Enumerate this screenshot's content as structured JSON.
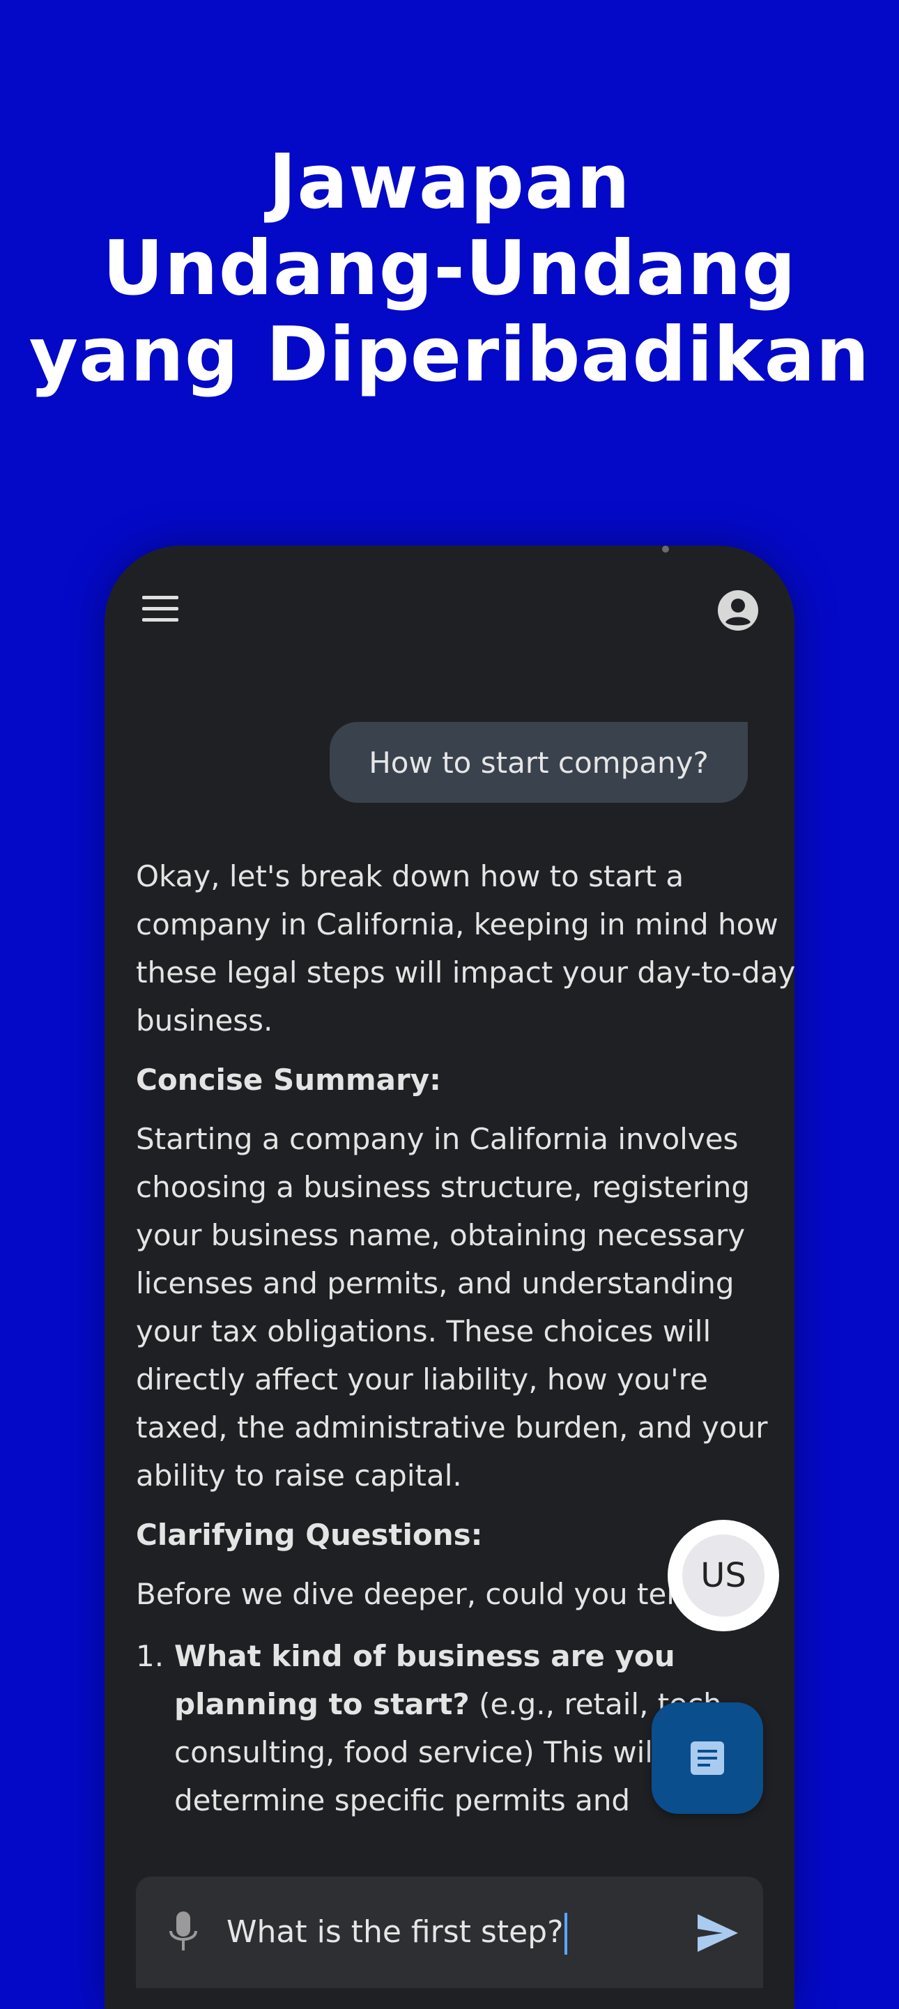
{
  "promo": {
    "title_lines": [
      "Jawapan",
      "Undang-Undang",
      "yang Diperibadikan"
    ]
  },
  "app": {
    "header": {
      "menu_icon": "hamburger-menu-icon",
      "account_icon": "account-circle-icon"
    },
    "user_message": "How to start company?",
    "answer": {
      "intro": "Okay, let's break down how to start a company in California, keeping in mind how these legal steps will impact your day-to-day business.",
      "summary_heading": "Concise Summary:",
      "summary_text": "Starting a company in California involves choosing a business structure, registering your business name, obtaining necessary licenses and permits, and understanding your tax obligations. These choices will directly affect your liability, how you're taxed, the administrative burden, and your ability to raise capital.",
      "questions_heading": "Clarifying Questions:",
      "questions_intro": "Before we dive deeper, could you tell me:",
      "questions": [
        {
          "number": "1.",
          "bold": "What kind of business are you planning to start?",
          "rest": " (e.g., retail, tech, consulting, food service) This will help determine specific permits and"
        }
      ]
    },
    "jurisdiction_button": "US",
    "doc_button_icon": "document-icon",
    "input": {
      "value": "What is the first step?",
      "mic_icon": "microphone-icon",
      "send_icon": "send-icon"
    },
    "colors": {
      "background": "#0409c8",
      "phone": "#1f2023",
      "user_bubble": "#3a424e",
      "doc_fab": "#0a4e8e",
      "accent": "#5aa8ff"
    }
  }
}
